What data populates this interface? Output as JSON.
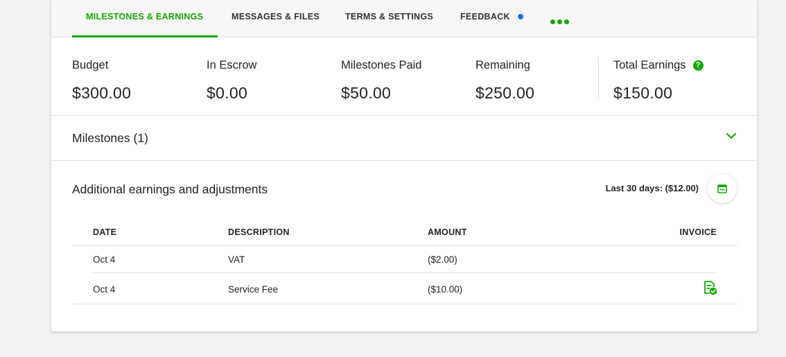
{
  "tabs": [
    {
      "label": "MILESTONES & EARNINGS",
      "active": true
    },
    {
      "label": "MESSAGES & FILES"
    },
    {
      "label": "TERMS & SETTINGS"
    },
    {
      "label": "FEEDBACK"
    }
  ],
  "more_icon": "more-dots-icon",
  "stats": {
    "budget": {
      "label": "Budget",
      "value": "$300.00"
    },
    "escrow": {
      "label": "In Escrow",
      "value": "$0.00"
    },
    "paid": {
      "label": "Milestones Paid",
      "value": "$50.00"
    },
    "remaining": {
      "label": "Remaining",
      "value": "$250.00"
    },
    "total": {
      "label": "Total Earnings",
      "value": "$150.00",
      "help": "?"
    }
  },
  "milestones": {
    "title": "Milestones (1)"
  },
  "additional": {
    "title": "Additional earnings and adjustments",
    "summary": "Last 30 days: ($12.00)",
    "columns": {
      "date": "DATE",
      "description": "DESCRIPTION",
      "amount": "AMOUNT",
      "invoice": "INVOICE"
    },
    "rows": [
      {
        "date": "Oct 4",
        "description": "VAT",
        "amount": "($2.00)",
        "invoice": ""
      },
      {
        "date": "Oct 4",
        "description": "Service Fee",
        "amount": "($10.00)",
        "invoice": "invoice-check-icon"
      }
    ]
  },
  "colors": {
    "accent": "#14a800",
    "notification": "#1f74d4"
  }
}
